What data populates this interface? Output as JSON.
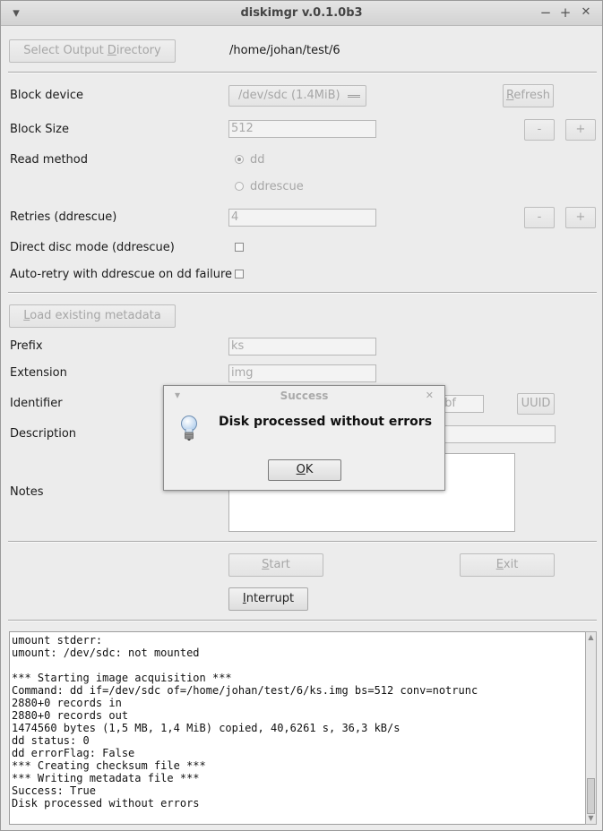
{
  "window": {
    "title": "diskimgr v.0.1.0b3",
    "menu_glyph": "▾",
    "min_glyph": "−",
    "max_glyph": "+",
    "close_glyph": "✕"
  },
  "output": {
    "select_btn_pre": "Select Output ",
    "select_btn_ul": "D",
    "select_btn_post": "irectory",
    "path": "/home/johan/test/6"
  },
  "block_device": {
    "label": "Block device",
    "value": "/dev/sdc (1.4MiB)",
    "refresh_ul": "R",
    "refresh_rest": "efresh"
  },
  "block_size": {
    "label": "Block Size",
    "value": "512",
    "minus": "-",
    "plus": "+"
  },
  "read_method": {
    "label": "Read method",
    "options": [
      "dd",
      "ddrescue"
    ],
    "selected": "dd"
  },
  "retries": {
    "label": "Retries (ddrescue)",
    "value": "4",
    "minus": "-",
    "plus": "+"
  },
  "direct_disc": {
    "label": "Direct disc mode (ddrescue)",
    "checked": false
  },
  "auto_retry": {
    "label": "Auto-retry with ddrescue on dd failure",
    "checked": false
  },
  "metadata": {
    "load_ul": "L",
    "load_rest": "oad existing metadata"
  },
  "prefix": {
    "label": "Prefix",
    "value": "ks"
  },
  "extension": {
    "label": "Extension",
    "value": "img"
  },
  "identifier": {
    "label": "Identifier",
    "value_visible": "bf",
    "uuid_btn": "UUID"
  },
  "description": {
    "label": "Description",
    "value": ""
  },
  "notes": {
    "label": "Notes",
    "value": ""
  },
  "actions": {
    "start_ul": "S",
    "start_rest": "tart",
    "exit_ul": "E",
    "exit_rest": "xit",
    "interrupt_ul": "I",
    "interrupt_rest": "nterrupt"
  },
  "log": {
    "text": "umount stderr:\numount: /dev/sdc: not mounted\n\n*** Starting image acquisition ***\nCommand: dd if=/dev/sdc of=/home/johan/test/6/ks.img bs=512 conv=notrunc\n2880+0 records in\n2880+0 records out\n1474560 bytes (1,5 MB, 1,4 MiB) copied, 40,6261 s, 36,3 kB/s\ndd status: 0\ndd errorFlag: False\n*** Creating checksum file ***\n*** Writing metadata file ***\nSuccess: True\nDisk processed without errors"
  },
  "dialog": {
    "title": "Success",
    "message": "Disk processed without errors",
    "ok_ul": "O",
    "ok_rest": "K",
    "close_glyph": "✕",
    "menu_glyph": "▾",
    "icon": "lightbulb-info-icon"
  },
  "colors": {
    "window_bg": "#ececec",
    "disabled_text": "#a6a6a6",
    "dialog_bg": "#efefef"
  }
}
